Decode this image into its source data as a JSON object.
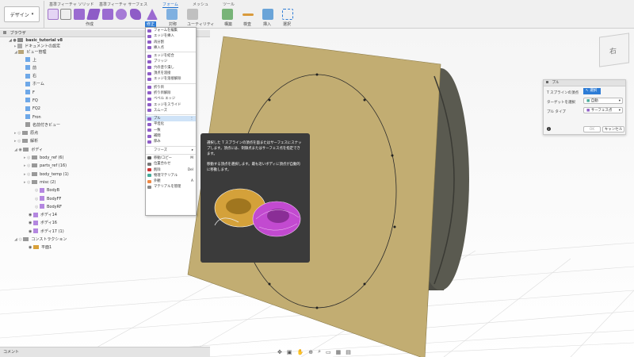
{
  "ribbon": {
    "design_label": "デザイン",
    "tabs": [
      "基準フィーチャ ソリッド",
      "基準フィーチャ サーフェス",
      "フォーム",
      "メッシュ",
      "ツール"
    ],
    "groups": [
      "作成",
      "修正",
      "対称",
      "ユーティリティ",
      "構築",
      "検査",
      "挿入",
      "選択"
    ]
  },
  "browser": {
    "title": "ブラウザ",
    "items": [
      "basic_tutorial v8",
      "ドキュメントの設定",
      "ビュー管理",
      "上",
      "前",
      "右",
      "ホーム",
      "F",
      "FQ",
      "FQ2",
      "Fron",
      "名前付きビュー",
      "原点",
      "解析",
      "ボディ",
      "body_ref (6)",
      "parts_ref (16)",
      "body_temp (1)",
      "misc (2)",
      "BodyB",
      "BodyFF",
      "BodyRF",
      "ボディ14",
      "ボディ16",
      "ボディ17 (1)",
      "コンストラクション",
      "平面1"
    ]
  },
  "menu": {
    "items": [
      "フォームを編集",
      "エッジを挿入",
      "再分割",
      "挿入点",
      "エッジを結合",
      "ブリッジ",
      "穴の塗り潰し",
      "頂点を溶接",
      "エッジを溶接解除",
      "折り目",
      "折り目解除",
      "ベベル エッジ",
      "エッジをスライド",
      "スムーズ",
      "プル",
      "平坦化",
      "一致",
      "補間",
      "厚み",
      "フリーズ",
      "移動/コピー",
      "位置合わせ",
      "削除",
      "物理マテリアル",
      "外観",
      "マテリアルを管理"
    ],
    "shortcuts": [
      "M",
      "Del",
      "A"
    ]
  },
  "tooltip": {
    "p1": "選択した T スプラインの頂点を面またはサーフェスにスナップします。頂点には、制御点またはサーフェス点を指定できます。",
    "p2": "移動する頂点を選択します。最も近いボディに頂点が自動的に移動します。"
  },
  "pull_dialog": {
    "title": "プル",
    "row1_label": "T スプラインの頂点",
    "row1_value": "選択",
    "row2_label": "ターゲットを選択",
    "row2_value": "自動",
    "row3_label": "プル タイプ",
    "row3_value": "サーフェス点",
    "ok": "OK",
    "cancel": "キャンセル"
  },
  "viewcube_label": "右",
  "comments_label": "コメント",
  "colors": {
    "accent": "#2d7cd6",
    "plane": "#c2ad72",
    "body": "#4a4a42",
    "tooltip_bg": "#3b3b3b"
  }
}
